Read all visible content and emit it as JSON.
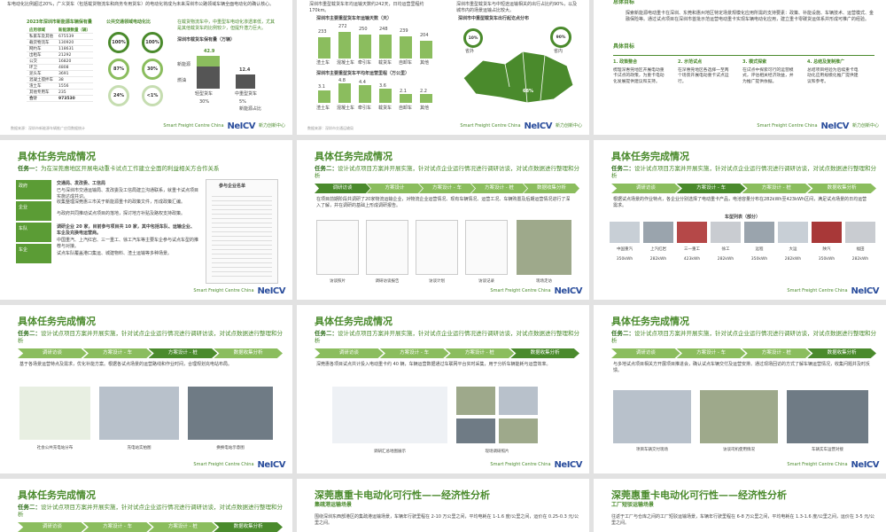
{
  "slides": {
    "s1": {
      "intro_text": "车电动化比例超过20%，广义货车（包括载货物流车和商务专用货车）的电动化将成为未来深圳市公路领域车辆全面电动化的确认核心。",
      "table_title": "2023年深圳市新能源车辆保有量",
      "table_headers": [
        "应用领域",
        "新能源数量（辆）"
      ],
      "table_rows": [
        [
          "私家车及其他",
          "675539"
        ],
        [
          "载货物流车",
          "130920"
        ],
        [
          "网约车",
          "118631"
        ],
        [
          "出租车",
          "21292"
        ],
        [
          "公交",
          "16820"
        ],
        [
          "环卫",
          "4808"
        ],
        [
          "泥头车",
          "3691"
        ],
        [
          "混凝土搅拌车",
          "38"
        ],
        [
          "渣土车",
          "1556"
        ],
        [
          "其他专用车",
          "235"
        ],
        [
          "合计",
          "973530"
        ]
      ],
      "donut_title": "公共交通领域电动化比",
      "donuts": [
        {
          "value": "100%",
          "label": "公交"
        },
        {
          "value": "100%",
          "label": "出租"
        },
        {
          "value": "87%",
          "label": "网约"
        },
        {
          "value": "30%",
          "label": "泥头车"
        },
        {
          "value": "24%",
          "label": "载货物流"
        },
        {
          "value": "<1%",
          "label": "搅拌车"
        }
      ],
      "right_note": "在载货物流车中，中重型车电动化渗透率低，尤其是其他载货车的比例较少，但提升潜力巨大。",
      "bar_title": "深圳市载货车保有量（万辆）",
      "bars": [
        {
          "label": "轻型货车",
          "value": 42.9
        },
        {
          "label": "中重型货车",
          "value": 12.4
        }
      ],
      "bar_annotations": [
        "42.9",
        "12.4",
        "30%",
        "5%"
      ],
      "pct_labels": [
        "30%",
        "5%"
      ],
      "legend": [
        "新能源",
        "燃油"
      ],
      "side_label": "新能源占比",
      "footer": "数据来源：深圳市新能源车辆推广应用数据统计"
    },
    "s2": {
      "intro_text": "深圳市重型载货车年均运输天数约242天，日均运营里程约170km。",
      "chart1_title": "深圳市主要重型货车年运输天数（天）",
      "chart1_values": [
        "233",
        "272",
        "250",
        "248",
        "239",
        "204"
      ],
      "chart1_cats": [
        "渣土车",
        "混凝土车",
        "牵引车",
        "载货车",
        "自卸车",
        "其他"
      ],
      "chart2_title": "深圳市主要重型货车平均年运营里程（万公里）",
      "chart2_values": [
        "3.1",
        "4.8",
        "4.4",
        "3.6",
        "2.1",
        "2.2"
      ],
      "chart2_cats": [
        "渣土车",
        "混凝土车",
        "牵引车",
        "载货车",
        "自卸车",
        "其他"
      ],
      "footer": "数据来源：深圳市交通运输局"
    },
    "s3": {
      "intro_text": "深圳市重型载货车与中短途运输相关的出行占比约90%，以及城市内的场景运输占比较大。",
      "map_title": "深圳市中重型载货车出行起讫点分布",
      "map_badges": [
        "10%",
        "90%"
      ],
      "map_labels": [
        "省外",
        "省内"
      ],
      "footer": "数据来源：深圳市货运车辆调研",
      "district_pct": "68%"
    },
    "s4": {
      "section_top": "总体目标",
      "intro_text": "探索新能源电动重卡在深圳、东莞和惠州地区特定场景规模化应用所需的支持要素：政策、补能设施、车辆技术、运营模式、金融保险等。通过试点项目在深圳市首批示范运营电动重卡实现车辆电动化应用，建立重卡零碳货运体系并形成可推广的经验。",
      "section2": "具体目标",
      "steps": [
        {
          "title": "1. 政策整合",
          "text": "梳理深惠莞地区开展电动重卡试点的政策，为重卡电动化发展提供建议和支持。"
        },
        {
          "title": "2. 示范试点",
          "text": "在深惠莞地区各选择一至两个场景开展电动重卡试点运行。"
        },
        {
          "title": "3. 模式探索",
          "text": "在试点中探索可行的运营模式，评估相关经济效益，并为推广提供依据。"
        },
        {
          "title": "4. 总结及复制推广",
          "text": "总结项目经验为后续重卡电动化应用规模化推广提供建议和参考。"
        }
      ],
      "footer": ""
    },
    "s5": {
      "title": "具体任务完成情况",
      "task_label": "任务一：",
      "task_text": "为在深莞惠地区开展电动重卡试点工作建立全面的利益相关方合作关系",
      "side_items": [
        "政府",
        "企业",
        "车队",
        "车企"
      ],
      "list_header": "交通局、发改委、工信局",
      "bullets": [
        "已与深圳市交通运输局、发改委及工信局建立沟通联系，就重卡试点项目实施达成共识。",
        "收集整理深莞惠三市关于新能源重卡的政策文件，形成政策汇编。",
        "与政府共同推动试点项目的落地，探讨地方补贴及路权支持政策。",
        "调研企业 20 家，目前参与项目共 10 家，其中包括车队、运输企业、车企及充换电运营商。",
        "中国重汽、上汽红岩、三一重工、徐工汽车等主要车企参与试点车型的推荐与对接。",
        "试点车队覆盖港口集运、城建物料、渣土运输等多种场景。"
      ],
      "doc_title": "参与企业名单"
    },
    "s6": {
      "title": "具体任务完成情况",
      "task_label": "任务二：",
      "task_text": "设计试点项目方案并开展实施，针对试点企业运行情况进行调研访谈，对试点数据进行整理和分析",
      "tabs": [
        "调研访谈",
        "方案设计",
        "方案设计 - 车",
        "方案设计 - 桩",
        "数据收集分析"
      ],
      "active_tab": 0,
      "bullets": "在项目前期阶段共调研了20家物流运输企业，对物流企业运营情况、现有车辆情况、运营工况、车辆购置及后期运营情况进行了深入了解，并在调研的基础上形成调研报告。",
      "images": [
        "访谈照片",
        "调研访谈报告",
        "访谈计划",
        "访谈记录",
        "现场走访"
      ]
    },
    "s7": {
      "title": "具体任务完成情况",
      "task_label": "任务二：",
      "task_text": "设计试点项目方案并开展实施，针对试点企业运行情况进行调研访谈，对试点数据进行整理和分析",
      "tabs": [
        "调研访谈",
        "方案设计 - 车",
        "方案设计 - 桩",
        "数据收集分析"
      ],
      "active_tab": 1,
      "bullets": "根据试点场景的作业特点，各企业分别选择了电动重卡产品，电池容量分布在282kWh至423kWh区间，满足试点场景的日均运营需求。",
      "vehicle_title": "车型列表（部分）",
      "vehicle_brands": [
        "中国重汽",
        "上汽红岩",
        "三一重工",
        "徐工",
        "远程",
        "大运",
        "陕汽",
        "福田"
      ],
      "vehicle_specs": [
        "350kWh",
        "282kWh",
        "423kWh",
        "282kWh",
        "350kWh",
        "282kWh",
        "350kWh",
        "282kWh"
      ]
    },
    "s8": {
      "title": "具体任务完成情况",
      "task_label": "任务二：",
      "task_text": "设计试点项目方案并开展实施，针对试点企业运行情况进行调研访谈，对试点数据进行整理和分析",
      "tabs": [
        "调研访谈",
        "方案设计 - 车",
        "方案设计 - 桩",
        "数据收集分析"
      ],
      "active_tab": 2,
      "bullets": "基于各场景运营特点及需求，优化补能方案。根据各试点场景的运营路线和作业时间，合理规划充电站布局。",
      "captions": [
        "社会公共充电站分布",
        "充电站实拍图",
        "换换电站示意图"
      ]
    },
    "s9": {
      "title": "具体任务完成情况",
      "task_label": "任务二：",
      "task_text": "设计试点项目方案并开展实施，针对试点企业运行情况进行调研访谈，对试点数据进行整理和分析",
      "tabs": [
        "调研访谈",
        "方案设计 - 车",
        "方案设计 - 桩",
        "数据收集分析"
      ],
      "active_tab": 3,
      "bullets": "深莞惠各项目试点共计投入电动重卡约 40 辆，车辆运营数据通过车联网平台实时采集，用于分析车辆能耗与运营效率。",
      "captions": [
        "调研汇总地图展示",
        "现场调研照片"
      ]
    },
    "s10": {
      "title": "具体任务完成情况",
      "task_label": "任务二：",
      "task_text": "设计试点项目方案并开展实施，针对试点企业运行情况进行调研访谈，对试点数据进行整理和分析",
      "tabs": [
        "调研访谈",
        "方案设计 - 车",
        "方案设计 - 桩",
        "数据收集分析"
      ],
      "active_tab": 3,
      "bullets": "与多地试点项目相关方开展项目推进会，确认试点车辆交付及运营安排。通过现场回访的方式了解车辆运营情况，收集问题并及时反馈。",
      "captions": [
        "项目车辆交付现场",
        "访谈司机使用情况",
        "车辆实车运营对接"
      ]
    },
    "s11": {
      "title": "具体任务完成情况",
      "task_label": "任务二：",
      "task_text": "设计试点项目方案并开展实施，针对试点企业运行情况进行调研访谈，对试点数据进行整理和分析",
      "tabs": [
        "调研访谈",
        "方案设计 - 车",
        "方案设计 - 桩",
        "数据收集分析"
      ],
      "active_tab": 3
    },
    "s12": {
      "title": "深莞惠重卡电动化可行性——经济性分析",
      "subtitle": "集疏港运输场景",
      "text": "围绕深圳东西部港区的集疏港运输场景，车辆年行驶里程在 2-10 万公里之间，平均电耗在 1-1.6 度/公里之间，运价在 0.25-0.3 元/公里之间。"
    },
    "s13": {
      "title": "深莞惠重卡电动化可行性——经济性分析",
      "subtitle": "工厂短驳运输场景",
      "text": "往返于工厂与仓库之间的工厂短驳运输场景，车辆年行驶里程在 6-8 万公里之间，平均电耗在 1.3-1.6 度/公里之间，运价在 3-5 元/公里之间。"
    }
  },
  "logo_a": "Smart Freight\nCentre China",
  "logo_b": "NeICV",
  "logo_b_sub": "新力创新中心",
  "colors": {
    "primary": "#4a8a2c",
    "light": "#8bbd5e",
    "brand_blue": "#2a4d9c"
  }
}
